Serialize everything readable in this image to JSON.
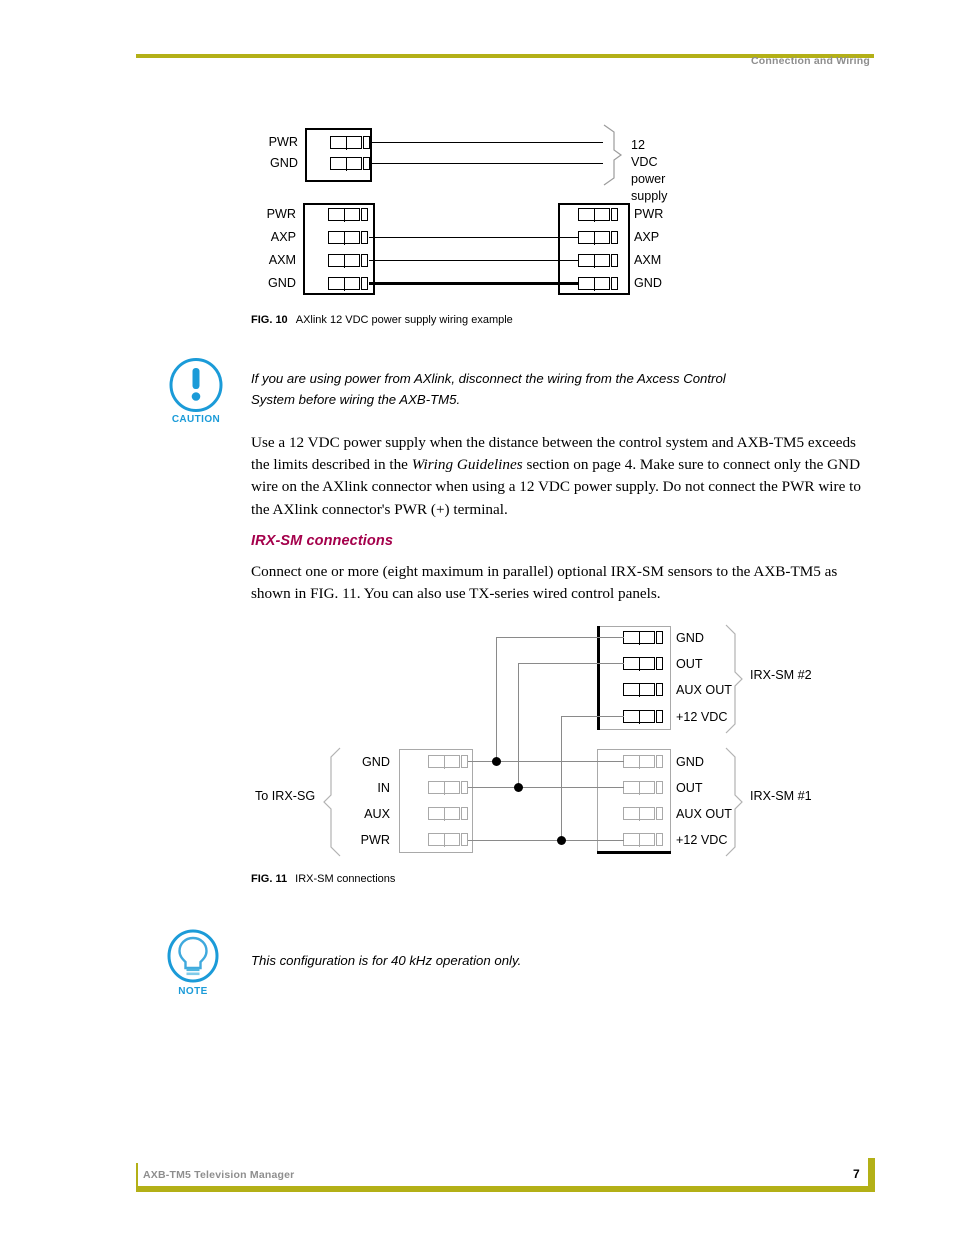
{
  "header": {
    "title": "Connection and Wiring",
    "rule_color": "#b3b017"
  },
  "footer": {
    "title": "AXB-TM5 Television Manager",
    "page_number": "7",
    "rule_color": "#b3b017"
  },
  "figure_10": {
    "caption_prefix": "FIG. 10",
    "caption_text": "AXlink 12 VDC power supply wiring example",
    "power_supply_label_line1": "12 VDC power",
    "power_supply_label_line2": "supply",
    "top_connector_pins": [
      "PWR",
      "GND"
    ],
    "bottom_left_connector_pins": [
      "PWR",
      "AXP",
      "AXM",
      "GND"
    ],
    "bottom_right_connector_pins": [
      "PWR",
      "AXP",
      "AXM",
      "GND"
    ]
  },
  "caution": {
    "label": "CAUTION",
    "icon": "exclamation-circle-icon",
    "accent_color": "#1b9bd8",
    "text": "If you are using power from AXlink, disconnect the wiring from the Axcess Control System before wiring the AXB-TM5."
  },
  "body_paragraph_1": {
    "segment_1": "Use a 12 VDC power supply when the distance between the control system and AXB-TM5 exceeds the limits described in the ",
    "italic_1": "Wiring Guidelines",
    "segment_2": " section on page 4. Make sure to connect only the GND wire on the AXlink connector when using a 12 VDC power supply. Do not connect the PWR wire to the AXlink connector's PWR (+) terminal."
  },
  "section_irx_sm": {
    "heading": "IRX-SM connections",
    "heading_color": "#a4004b",
    "paragraph": "Connect one or more (eight maximum in parallel) optional IRX-SM sensors to the AXB-TM5 as shown in FIG. 11. You can also use TX-series wired control panels."
  },
  "figure_11": {
    "caption_prefix": "FIG. 11",
    "caption_text": "IRX-SM connections",
    "left_device_label": "To IRX-SG",
    "left_connector_pins": [
      "GND",
      "IN",
      "AUX",
      "PWR"
    ],
    "irx_sm_2_label": "IRX-SM #2",
    "irx_sm_2_pins": [
      "GND",
      "OUT",
      "AUX OUT",
      "+12 VDC"
    ],
    "irx_sm_1_label": "IRX-SM #1",
    "irx_sm_1_pins": [
      "GND",
      "OUT",
      "AUX OUT",
      "+12 VDC"
    ]
  },
  "note": {
    "label": "NOTE",
    "icon": "lightbulb-icon",
    "accent_color": "#1b9bd8",
    "text": "This configuration is for 40 kHz operation only."
  }
}
